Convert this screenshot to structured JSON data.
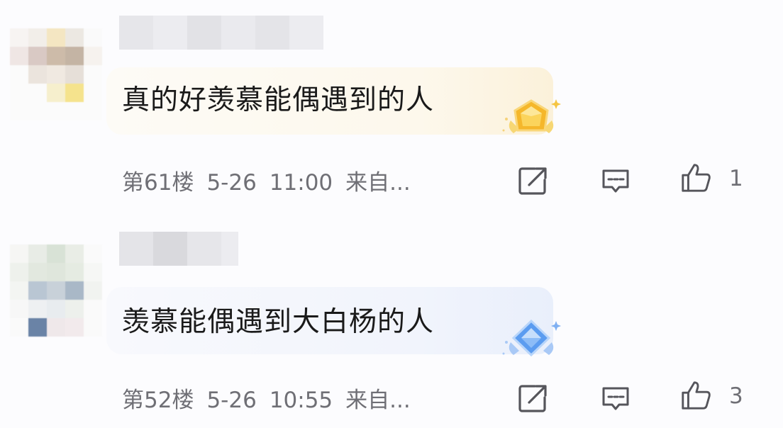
{
  "comments": [
    {
      "text": "真的好羡慕能偶遇到的人",
      "floor": "第61楼",
      "date": "5-26",
      "time": "11:00",
      "source": "来自...",
      "likes": "1",
      "badge": "gold-medal-icon",
      "bubble_color": "#fdf8ec",
      "badge_color": "#f7b928"
    },
    {
      "text": "羡慕能偶遇到大白杨的人",
      "floor": "第52楼",
      "date": "5-26",
      "time": "10:55",
      "source": "来自...",
      "likes": "3",
      "badge": "blue-diamond-icon",
      "bubble_color": "#f1f4fc",
      "badge_color": "#5b9cf0"
    }
  ]
}
